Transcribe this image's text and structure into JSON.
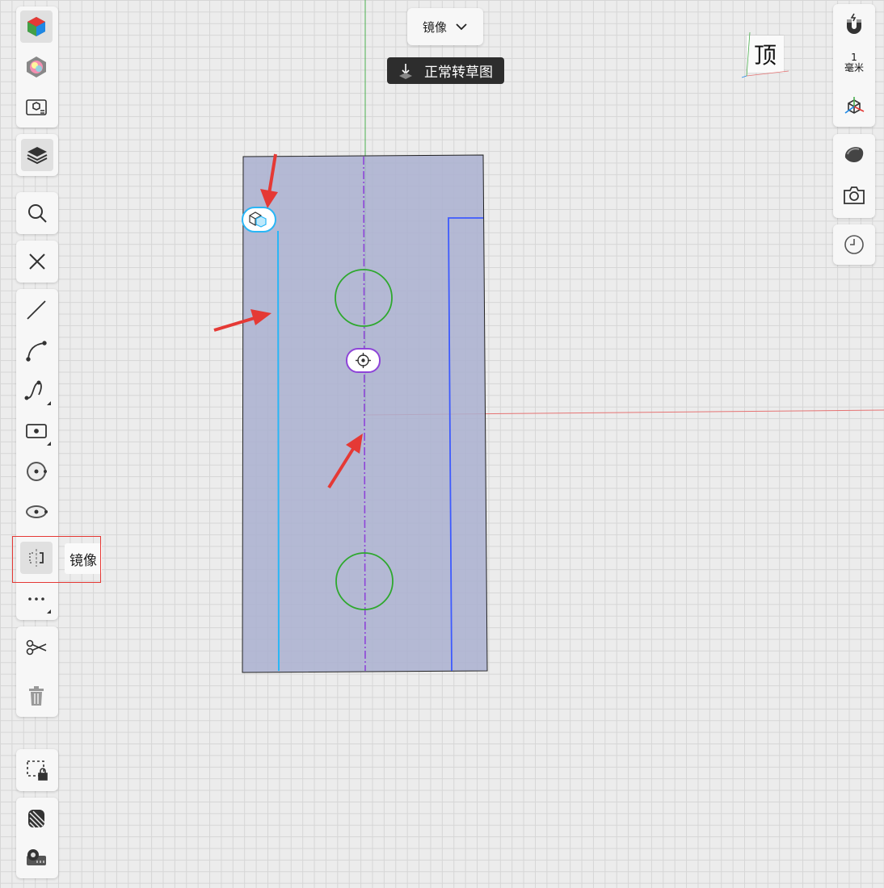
{
  "toolbar_top": {
    "mirror_dropdown_label": "镜像",
    "normal_to_sketch_label": "正常转草图"
  },
  "view_cube": {
    "face_label": "顶"
  },
  "tooltip": {
    "label": "镜像"
  },
  "right_panel": {
    "scale_value": "1",
    "scale_unit": "毫米"
  },
  "colors": {
    "sketch_fill": "#aab0d0",
    "axis_red": "#e57373",
    "axis_green": "#4caf50",
    "circle_green": "#2ea82e",
    "selected_line_cyan": "#29b6f6",
    "sketch_line_blue": "#3d5afe",
    "centerline_purple": "#8e44d8",
    "annotation_red": "#e53935"
  },
  "icons": {
    "left": [
      "cube-color-icon",
      "color-wheel-icon",
      "view-box-icon",
      "layers-icon",
      "search-icon",
      "close-icon",
      "line-icon",
      "arc-icon",
      "spline-icon",
      "rectangle-icon",
      "circle-icon",
      "ellipse-icon",
      "mirror-icon",
      "more-icon",
      "scissors-icon",
      "trash-icon",
      "selection-lock-icon",
      "pattern-icon",
      "measure-icon"
    ],
    "right": [
      "magnet-icon",
      "axis-icon",
      "material-ball-icon",
      "camera-icon",
      "clock-icon"
    ]
  }
}
